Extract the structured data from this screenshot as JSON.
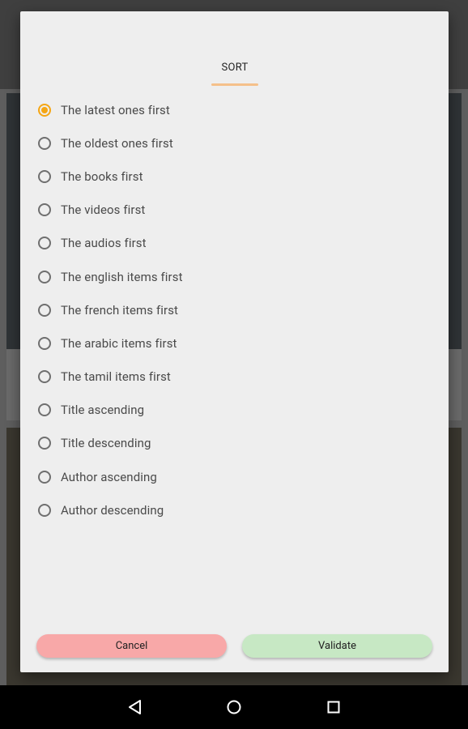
{
  "dialog": {
    "tab_label": "SORT",
    "options": [
      {
        "label": "The latest ones first",
        "checked": true
      },
      {
        "label": "The oldest ones first",
        "checked": false
      },
      {
        "label": "The books first",
        "checked": false
      },
      {
        "label": "The videos first",
        "checked": false
      },
      {
        "label": "The audios first",
        "checked": false
      },
      {
        "label": "The english items first",
        "checked": false
      },
      {
        "label": "The french items first",
        "checked": false
      },
      {
        "label": "The arabic items first",
        "checked": false
      },
      {
        "label": "The tamil items first",
        "checked": false
      },
      {
        "label": "Title ascending",
        "checked": false
      },
      {
        "label": "Title descending",
        "checked": false
      },
      {
        "label": "Author ascending",
        "checked": false
      },
      {
        "label": "Author descending",
        "checked": false
      }
    ],
    "cancel_label": "Cancel",
    "validate_label": "Validate"
  },
  "colors": {
    "accent": "#f5a614",
    "tab_underline": "#f5c08a",
    "cancel_bg": "#f8a8a8",
    "validate_bg": "#c7e8c4"
  },
  "navbar": {
    "icons": [
      "back-icon",
      "home-icon",
      "recent-apps-icon"
    ]
  }
}
